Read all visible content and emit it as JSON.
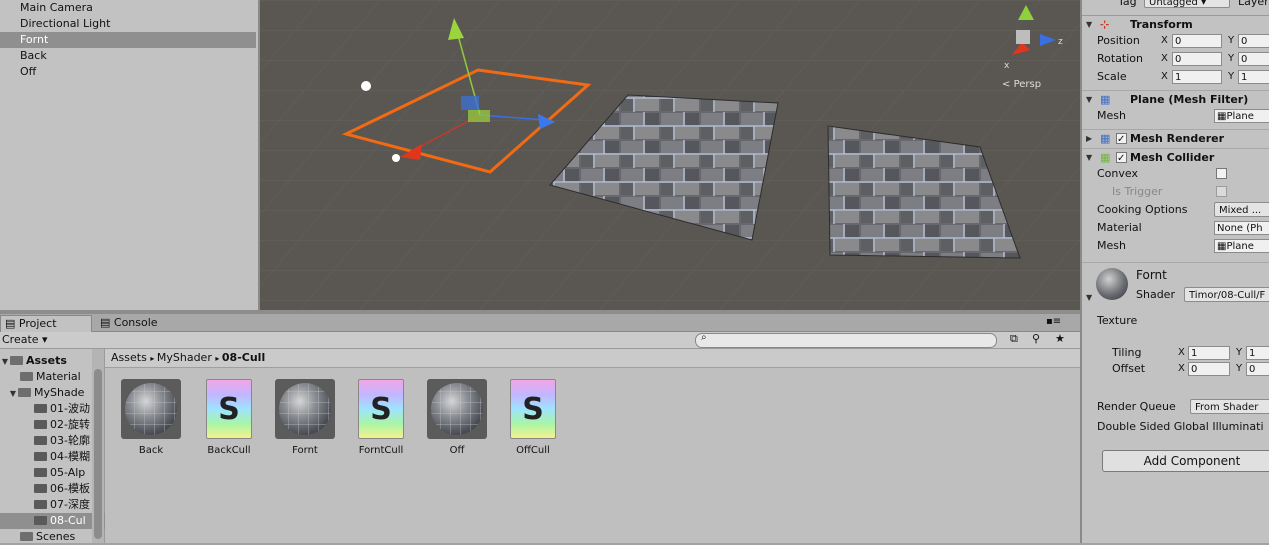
{
  "hierarchy": {
    "items": [
      {
        "label": "Main Camera"
      },
      {
        "label": "Directional Light"
      },
      {
        "label": "Fornt"
      },
      {
        "label": "Back"
      },
      {
        "label": "Off"
      }
    ]
  },
  "scene": {
    "persp_label": "Persp",
    "axis_z": "z",
    "axis_x": "x"
  },
  "project": {
    "tab_project": "Project",
    "tab_console": "Console",
    "create_label": "Create",
    "breadcrumb": [
      "Assets",
      "MyShader",
      "08-Cull"
    ],
    "tree": [
      {
        "label": "Assets",
        "bold": true
      },
      {
        "label": "Material"
      },
      {
        "label": "MyShade"
      },
      {
        "label": "01-波动"
      },
      {
        "label": "02-旋转"
      },
      {
        "label": "03-轮廓"
      },
      {
        "label": "04-模糊"
      },
      {
        "label": "05-Alp"
      },
      {
        "label": "06-模板"
      },
      {
        "label": "07-深度"
      },
      {
        "label": "08-Cul"
      },
      {
        "label": "Scenes"
      }
    ],
    "assets": [
      {
        "label": "Back",
        "kind": "material"
      },
      {
        "label": "BackCull",
        "kind": "shader"
      },
      {
        "label": "Fornt",
        "kind": "material"
      },
      {
        "label": "ForntCull",
        "kind": "shader"
      },
      {
        "label": "Off",
        "kind": "material"
      },
      {
        "label": "OffCull",
        "kind": "shader"
      }
    ],
    "shader_glyph": "S"
  },
  "inspector": {
    "tag_label": "Tag",
    "tag_value": "Untagged",
    "layer_label": "Layer",
    "transform": {
      "title": "Transform",
      "position_label": "Position",
      "rotation_label": "Rotation",
      "scale_label": "Scale",
      "x": "X",
      "y": "Y",
      "position": [
        "0",
        "0"
      ],
      "rotation": [
        "0",
        "0"
      ],
      "scale": [
        "1",
        "1"
      ]
    },
    "mesh_filter": {
      "title": "Plane (Mesh Filter)",
      "mesh_label": "Mesh",
      "mesh_value": "Plane"
    },
    "mesh_renderer": {
      "title": "Mesh Renderer"
    },
    "mesh_collider": {
      "title": "Mesh Collider",
      "convex_label": "Convex",
      "is_trigger_label": "Is Trigger",
      "cooking_label": "Cooking Options",
      "cooking_value": "Mixed ...",
      "material_label": "Material",
      "material_value": "None (Ph",
      "mesh_label": "Mesh",
      "mesh_value": "Plane"
    },
    "material": {
      "name": "Fornt",
      "shader_label": "Shader",
      "shader_value": "Timor/08-Cull/F",
      "texture_label": "Texture",
      "tiling_label": "Tiling",
      "offset_label": "Offset",
      "x": "X",
      "y": "Y",
      "tiling": [
        "1",
        "1"
      ],
      "offset": [
        "0",
        "0"
      ],
      "render_queue_label": "Render Queue",
      "render_queue_value": "From Shader",
      "double_sided_label": "Double Sided Global Illuminati"
    },
    "add_component": "Add Component"
  }
}
